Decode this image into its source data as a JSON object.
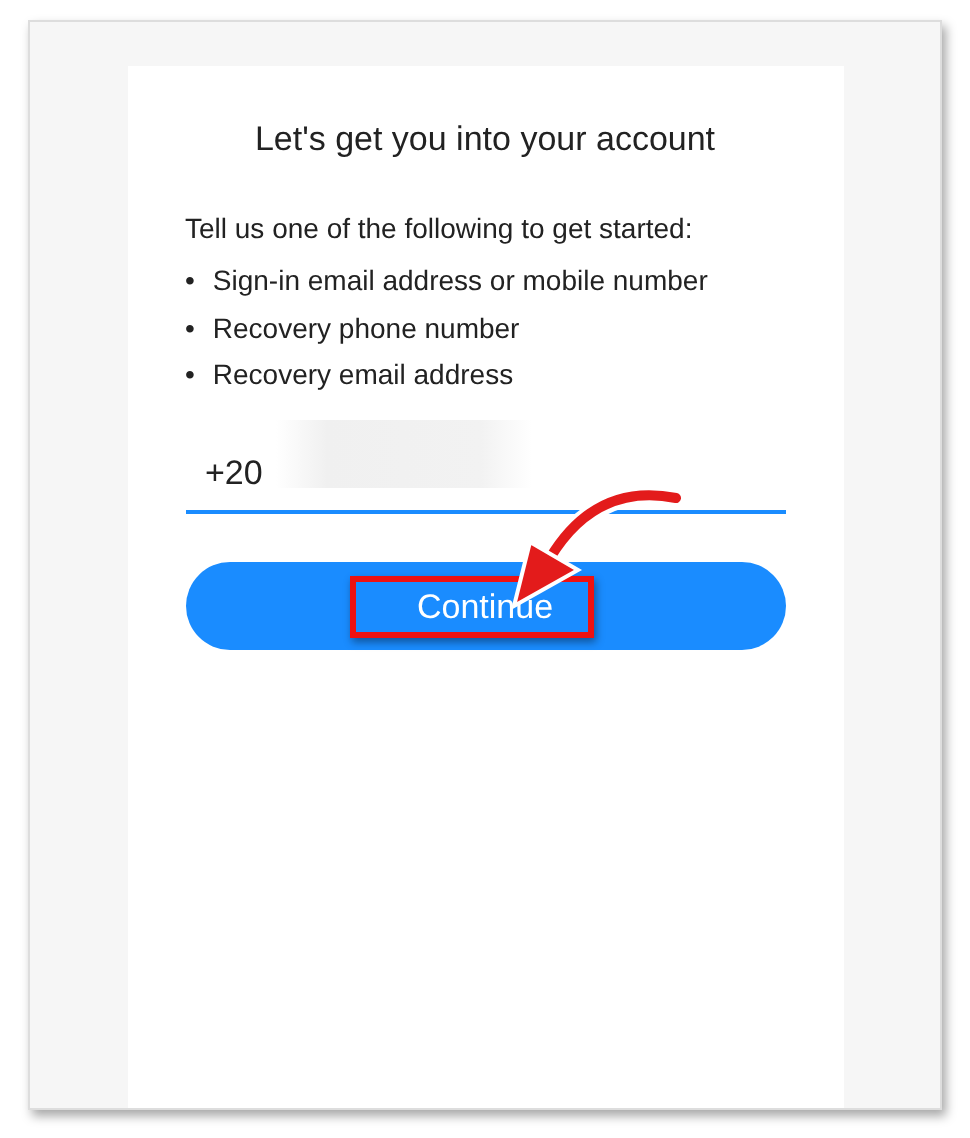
{
  "heading": "Let's get you into your account",
  "intro": "Tell us one of the following to get started:",
  "options": [
    {
      "bullet": "•",
      "text": "Sign-in email address or mobile number"
    },
    {
      "bullet": "•",
      "text": "Recovery phone number"
    },
    {
      "bullet": "•",
      "text": "Recovery email address"
    }
  ],
  "field": {
    "value": "+20"
  },
  "button": {
    "label": "Continue"
  }
}
